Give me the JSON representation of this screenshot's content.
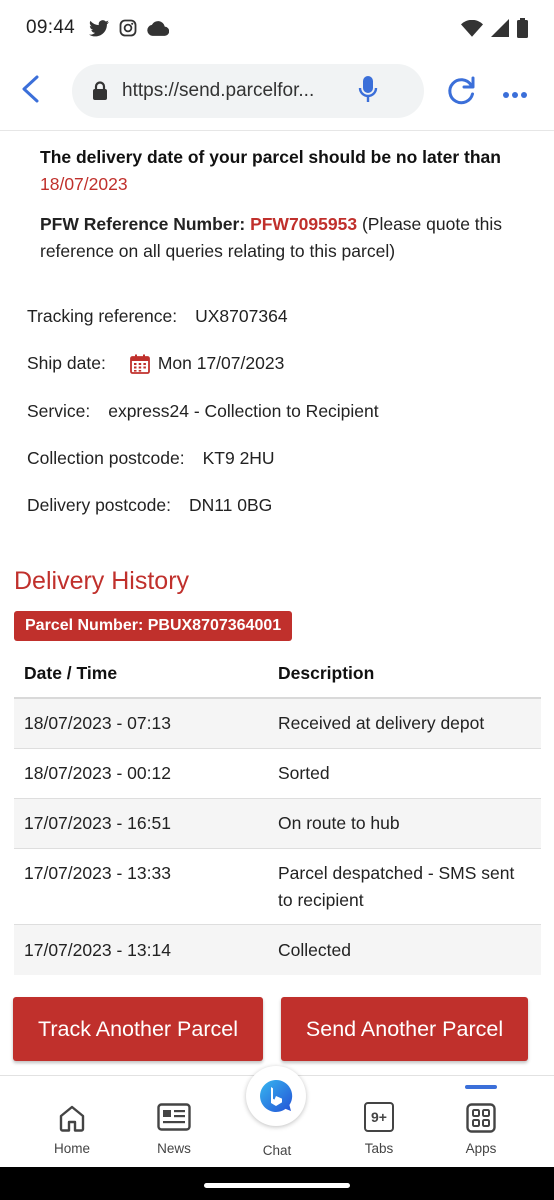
{
  "status_bar": {
    "time": "09:44",
    "left_icons": [
      "twitter-icon",
      "instagram-icon",
      "cloud-icon"
    ],
    "right_icons": [
      "wifi-icon",
      "signal-icon",
      "battery-icon"
    ]
  },
  "browser": {
    "url": "https://send.parcelfor...",
    "icons": [
      "back-arrow-icon",
      "lock-icon",
      "mic-icon",
      "reload-icon",
      "more-icon"
    ]
  },
  "notice": {
    "prefix": "The delivery date of your parcel should be no later than",
    "date": "18/07/2023"
  },
  "pfw": {
    "label": "PFW Reference Number:",
    "value": "PFW7095953",
    "note": "(Please quote this reference on all queries relating to this parcel)"
  },
  "details": {
    "tracking_label": "Tracking reference:",
    "tracking_value": "UX8707364",
    "ship_label": "Ship date:",
    "ship_value": "Mon 17/07/2023",
    "service_label": "Service:",
    "service_value": "express24 - Collection to Recipient",
    "collection_label": "Collection postcode:",
    "collection_value": "KT9 2HU",
    "delivery_label": "Delivery postcode:",
    "delivery_value": "DN11 0BG"
  },
  "history": {
    "title": "Delivery History",
    "parcel_number": "Parcel Number: PBUX8707364001",
    "columns": [
      "Date / Time",
      "Description"
    ],
    "rows": [
      {
        "date": "18/07/2023 - 07:13",
        "desc": "Received at delivery depot"
      },
      {
        "date": "18/07/2023 - 00:12",
        "desc": "Sorted"
      },
      {
        "date": "17/07/2023 - 16:51",
        "desc": "On route to hub"
      },
      {
        "date": "17/07/2023 - 13:33",
        "desc": "Parcel despatched - SMS sent to recipient"
      },
      {
        "date": "17/07/2023 - 13:14",
        "desc": "Collected"
      }
    ]
  },
  "buttons": {
    "track": "Track Another Parcel",
    "send": "Send Another Parcel"
  },
  "bottom_nav": {
    "home": "Home",
    "news": "News",
    "chat": "Chat",
    "tabs": "Tabs",
    "tabs_badge": "9+",
    "apps": "Apps"
  },
  "colors": {
    "accent_red": "#c0302c",
    "browser_blue": "#3b6fd9"
  }
}
